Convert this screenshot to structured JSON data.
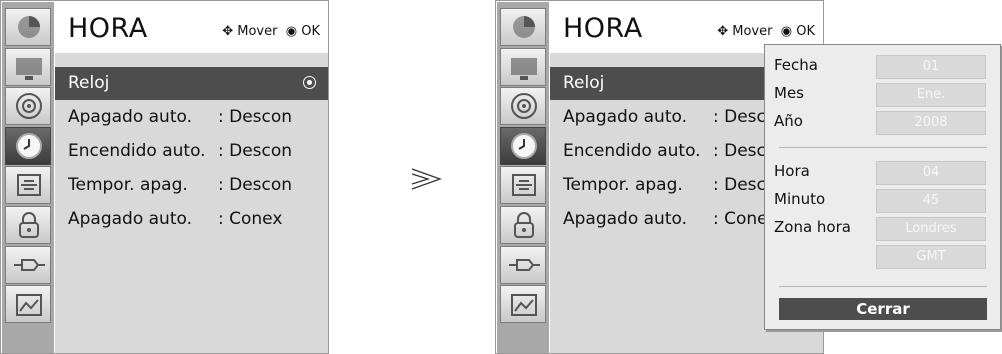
{
  "menu": {
    "title": "HORA",
    "hint_mover": "Mover",
    "hint_ok": "OK",
    "items": [
      {
        "label": "Reloj",
        "value": ""
      },
      {
        "label": "Apagado auto.",
        "value": ": Descon"
      },
      {
        "label": "Encendido auto.",
        "value": ": Descon"
      },
      {
        "label": "Tempor. apag.",
        "value": ": Descon"
      },
      {
        "label": "Apagado auto.",
        "value": ": Conex"
      }
    ],
    "side_icons": [
      "picture-icon",
      "screen-icon",
      "audio-icon",
      "clock-icon",
      "option-icon",
      "lock-icon",
      "input-icon",
      "usb-icon"
    ]
  },
  "right_menu": {
    "items": [
      {
        "label": "Reloj",
        "value": ""
      },
      {
        "label": "Apagado auto.",
        "value": ": Desco"
      },
      {
        "label": "Encendido auto.",
        "value": ": Desco"
      },
      {
        "label": "Tempor. apag.",
        "value": ": Desco"
      },
      {
        "label": "Apagado auto.",
        "value": ": Conex"
      }
    ],
    "hint_ok_partial": "OK"
  },
  "popup": {
    "rows": [
      {
        "label": "Fecha",
        "value": "01"
      },
      {
        "label": "Mes",
        "value": "Ene."
      },
      {
        "label": "Año",
        "value": "2008"
      },
      {
        "label": "Hora",
        "value": "04"
      },
      {
        "label": "Minuto",
        "value": "45"
      },
      {
        "label": "Zona hora",
        "value": "Londres"
      },
      {
        "label": "",
        "value": "GMT"
      }
    ],
    "close_label": "Cerrar"
  },
  "arrow_glyph": "≫"
}
